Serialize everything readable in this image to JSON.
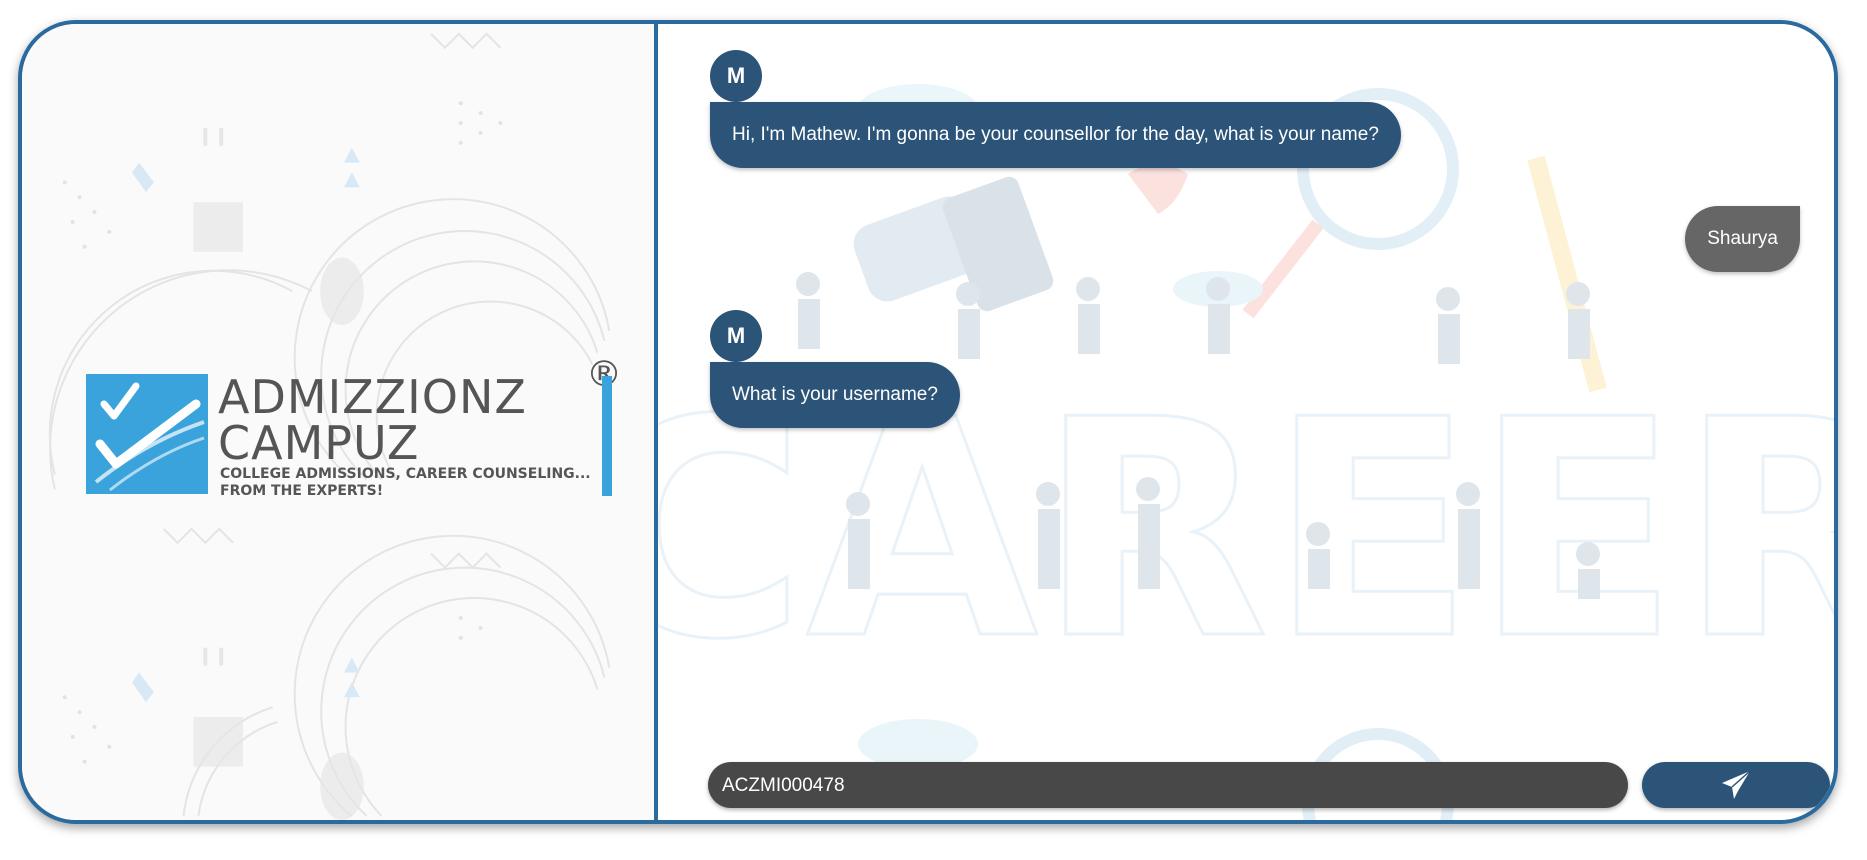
{
  "logo": {
    "brand_line1": "ADMIZZIONZ",
    "brand_line2": "CAMPUZ",
    "registered_mark": "®",
    "tagline_line1": "COLLEGE ADMISSIONS, CAREER COUNSELING...",
    "tagline_line2": "FROM THE EXPERTS!",
    "accent_color": "#3aa3dc"
  },
  "chat": {
    "background_word": "CAREER",
    "messages": [
      {
        "sender": "bot",
        "avatar_initial": "M",
        "text": "Hi, I'm Mathew. I'm gonna be your counsellor for the day, what is your name?"
      },
      {
        "sender": "user",
        "text": "Shaurya"
      },
      {
        "sender": "bot",
        "avatar_initial": "M",
        "text": "What is your username?"
      }
    ],
    "bot_bubble_color": "#2b5478",
    "user_bubble_color": "#666666"
  },
  "composer": {
    "input_value": "ACZMI000478",
    "send_icon": "paper-plane-icon"
  },
  "theme": {
    "frame_border_color": "#2a6a9e"
  }
}
